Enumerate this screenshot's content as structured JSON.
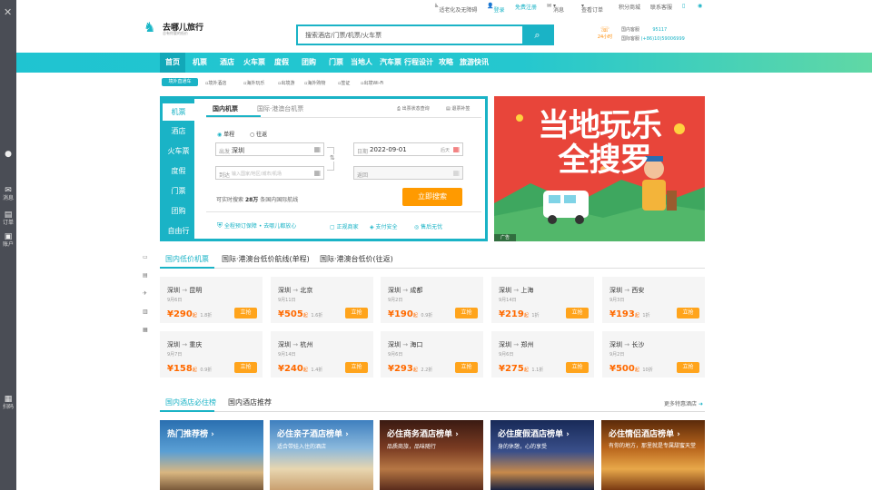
{
  "sidebar": {
    "close": "✕",
    "items": [
      {
        "icon": "user-icon",
        "label": ""
      },
      {
        "icon": "mail-icon",
        "label": "消息"
      },
      {
        "icon": "order-icon",
        "label": "订单"
      },
      {
        "icon": "account-icon",
        "label": "账户"
      },
      {
        "icon": "qrcode-icon",
        "label": "扫码"
      }
    ]
  },
  "topbar": {
    "accessibility": "适老化及无障碍",
    "login": "登录",
    "register": "免费注册",
    "messages": "消息",
    "order_query": "查看订单",
    "points": "积分商城",
    "contact": "联系客服"
  },
  "logo": {
    "name": "去哪儿旅行",
    "slogan": "总有你要的低价"
  },
  "search": {
    "placeholder": "搜索酒店/门票/机票/火车票"
  },
  "service": {
    "badge": "24小时",
    "domestic_label": "国内客服",
    "domestic_number": "95117",
    "intl_label": "国际客服",
    "intl_number": "(+86)10)59006999"
  },
  "nav": {
    "items": [
      "首页",
      "机票",
      "酒店",
      "火车票",
      "度假",
      "团购",
      "门票",
      "当地人",
      "汽车票",
      "行程设计",
      "攻略",
      "旅游快讯"
    ]
  },
  "subnav": {
    "tag": "境外直通车",
    "items": [
      "境外酒店",
      "海外玩乐",
      "出境游",
      "海外购物",
      "签证",
      "出境Wi-Fi"
    ]
  },
  "booking": {
    "left_tabs": [
      "机票",
      "酒店",
      "火车票",
      "度假",
      "门票",
      "团购",
      "自由行"
    ],
    "tabs": [
      "国内机票",
      "国际·港澳台机票"
    ],
    "status_link": "出票状态查询",
    "refund_link": "退票补签",
    "trip_types": [
      "单程",
      "往返"
    ],
    "from_label": "出发",
    "from_value": "深圳",
    "to_label": "到达",
    "to_placeholder": "输入国家/地区/城市/机场",
    "date_label": "日期",
    "date_value": "2022-09-01",
    "date_note": "后天",
    "return_label": "返回",
    "hint_prefix": "可实时搜索",
    "hint_count": "28万",
    "hint_suffix": "条国内国际航线",
    "search_button": "立即搜索",
    "guarantees": [
      "全程预订保障 • 去哪儿都放心",
      "正规商家",
      "支付安全",
      "售后无忧"
    ]
  },
  "banner": {
    "title_line1": "当地玩乐",
    "title_line2": "全搜罗",
    "ad": "广告"
  },
  "flights_section": {
    "tabs": [
      "国内低价机票",
      "国际·港澳台低价航线(单程)",
      "国际·港澳台低价(往返)"
    ],
    "book_label": "立抢",
    "price_unit": "起",
    "cards": [
      {
        "from": "深圳",
        "to": "昆明",
        "date": "9月6日",
        "price": "290",
        "discount": "1.8折"
      },
      {
        "from": "深圳",
        "to": "北京",
        "date": "9月11日",
        "price": "505",
        "discount": "1.6折"
      },
      {
        "from": "深圳",
        "to": "成都",
        "date": "9月2日",
        "price": "190",
        "discount": "0.9折"
      },
      {
        "from": "深圳",
        "to": "上海",
        "date": "9月14日",
        "price": "219",
        "discount": "1折"
      },
      {
        "from": "深圳",
        "to": "西安",
        "date": "9月3日",
        "price": "193",
        "discount": "1折"
      },
      {
        "from": "深圳",
        "to": "重庆",
        "date": "9月7日",
        "price": "158",
        "discount": "0.9折"
      },
      {
        "from": "深圳",
        "to": "杭州",
        "date": "9月14日",
        "price": "240",
        "discount": "1.4折"
      },
      {
        "from": "深圳",
        "to": "海口",
        "date": "9月6日",
        "price": "293",
        "discount": "2.2折"
      },
      {
        "from": "深圳",
        "to": "郑州",
        "date": "9月6日",
        "price": "275",
        "discount": "1.1折"
      },
      {
        "from": "深圳",
        "to": "长沙",
        "date": "9月2日",
        "price": "500",
        "discount": "10折"
      }
    ]
  },
  "hotel_section": {
    "tabs": [
      "国内酒店必住榜",
      "国内酒店推荐"
    ],
    "more": "更多特惠酒店",
    "cards": [
      {
        "title": "热门推荐榜 ›",
        "sub": ""
      },
      {
        "title": "必住亲子酒店榜单 ›",
        "sub": "适合带娃入住的酒店"
      },
      {
        "title": "必住商务酒店榜单 ›",
        "sub": "品质商旅，品味随行"
      },
      {
        "title": "必住度假酒店榜单 ›",
        "sub": "身的休憩，心的享受"
      },
      {
        "title": "必住情侣酒店榜单 ›",
        "sub": "有你的地方，那里就是专属甜蜜天堂"
      }
    ]
  },
  "colors": {
    "accent": "#1ab3c6",
    "orange": "#ff9a00",
    "price": "#ff6a00",
    "banner": "#e8453a"
  }
}
